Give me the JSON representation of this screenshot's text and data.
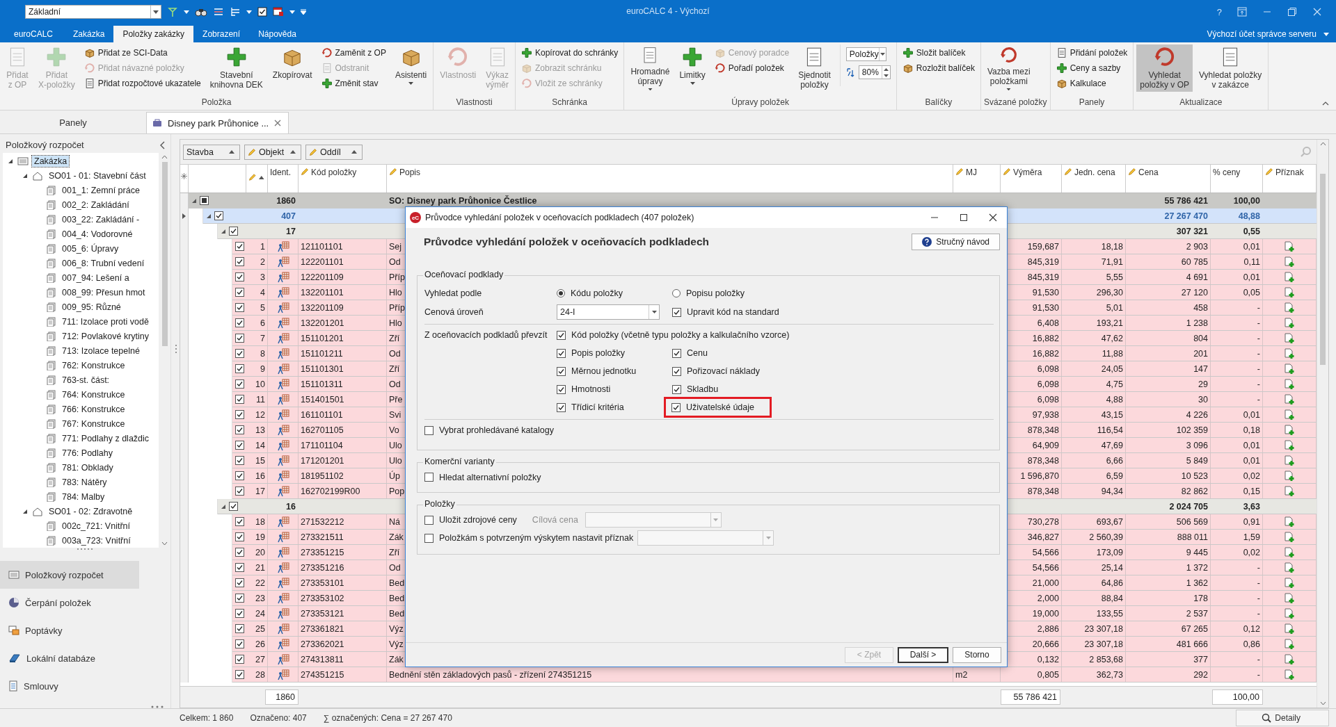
{
  "window": {
    "layout_combo": "Základní",
    "title": "euroCALC 4 - Výchozí",
    "help": "?"
  },
  "ribbon_tabs": [
    {
      "label": "euroCALC",
      "kind": "app",
      "selected": false
    },
    {
      "label": "Zakázka",
      "kind": "tab",
      "selected": false
    },
    {
      "label": "Položky zakázky",
      "kind": "tab",
      "selected": true
    },
    {
      "label": "Zobrazení",
      "kind": "tab",
      "selected": false
    },
    {
      "label": "Nápověda",
      "kind": "tab",
      "selected": false
    }
  ],
  "account": "Výchozí účet správce serveru",
  "ribbon_groups": [
    {
      "label": "Položka",
      "items": [
        {
          "kind": "large",
          "label": "Přidat\nz OP",
          "disabled": true,
          "dropdown": false,
          "pressed": false
        },
        {
          "kind": "large",
          "label": "Přidat\nX-položky",
          "disabled": true,
          "dropdown": false,
          "pressed": false
        },
        {
          "kind": "stack",
          "items": [
            {
              "label": "Přidat ze SCI-Data",
              "disabled": false
            },
            {
              "label": "Přidat návazné položky",
              "disabled": true
            },
            {
              "label": "Přidat rozpočtové ukazatele",
              "disabled": false
            }
          ]
        },
        {
          "kind": "large",
          "label": "Stavební\nknihovna DEK",
          "disabled": false,
          "dropdown": false,
          "pressed": false
        },
        {
          "kind": "large",
          "label": "Zkopírovat",
          "disabled": false,
          "dropdown": false,
          "pressed": false
        },
        {
          "kind": "stack",
          "items": [
            {
              "label": "Zaměnit z OP",
              "disabled": false
            },
            {
              "label": "Odstranit",
              "disabled": true
            },
            {
              "label": "Změnit stav",
              "disabled": false
            }
          ]
        },
        {
          "kind": "large",
          "label": "Asistenti",
          "disabled": false,
          "dropdown": true,
          "pressed": false
        }
      ]
    },
    {
      "label": "Vlastnosti",
      "items": [
        {
          "kind": "large",
          "label": "Vlastnosti",
          "disabled": true,
          "dropdown": false,
          "pressed": false
        },
        {
          "kind": "large",
          "label": "Výkaz\nvýměr",
          "disabled": true,
          "dropdown": false,
          "pressed": false
        }
      ]
    },
    {
      "label": "Schránka",
      "items": [
        {
          "kind": "stack",
          "items": [
            {
              "label": "Kopírovat do schránky",
              "disabled": false
            },
            {
              "label": "Zobrazit schránku",
              "disabled": true
            },
            {
              "label": "Vložit ze schránky",
              "disabled": true
            }
          ]
        }
      ]
    },
    {
      "label": "Úpravy položek",
      "items": [
        {
          "kind": "large",
          "label": "Hromadné\núpravy",
          "disabled": false,
          "dropdown": true,
          "pressed": false
        },
        {
          "kind": "large",
          "label": "Limitky",
          "disabled": false,
          "dropdown": true,
          "pressed": false
        },
        {
          "kind": "stack",
          "items": [
            {
              "label": "Cenový poradce",
              "disabled": true
            },
            {
              "label": "Pořadí položek",
              "disabled": false
            }
          ]
        },
        {
          "kind": "large",
          "label": "Sjednotit\npoložky",
          "disabled": false,
          "dropdown": false,
          "pressed": false
        },
        {
          "kind": "controls",
          "combo": "Položky",
          "spin": "80%"
        }
      ]
    },
    {
      "label": "Balíčky",
      "items": [
        {
          "kind": "stack",
          "items": [
            {
              "label": "Složit balíček",
              "disabled": false
            },
            {
              "label": "Rozložit balíček",
              "disabled": false
            }
          ]
        }
      ]
    },
    {
      "label": "Svázané položky",
      "items": [
        {
          "kind": "large",
          "label": "Vazba mezi\npoložkami",
          "disabled": false,
          "dropdown": true,
          "pressed": false
        }
      ]
    },
    {
      "label": "Panely",
      "items": [
        {
          "kind": "stack",
          "items": [
            {
              "label": "Přidání položek",
              "disabled": false
            },
            {
              "label": "Ceny a sazby",
              "disabled": false
            },
            {
              "label": "Kalkulace",
              "disabled": false
            }
          ]
        }
      ]
    },
    {
      "label": "Aktualizace",
      "items": [
        {
          "kind": "large",
          "label": "Vyhledat\npoložky v OP",
          "disabled": false,
          "dropdown": false,
          "pressed": true
        },
        {
          "kind": "large",
          "label": "Vyhledat položky\nv zakázce",
          "disabled": false,
          "dropdown": false,
          "pressed": false
        }
      ]
    }
  ],
  "panels_header": "Panely",
  "doc_tab": {
    "label": "Disney park Průhonice ..."
  },
  "side_panel": {
    "title": "Položkový rozpočet",
    "tree": [
      {
        "label": "Zakázka",
        "selected": true,
        "expanded": true,
        "children": [
          {
            "label": "SO01 - 01: Stavební část",
            "selected": false,
            "expanded": true,
            "children": [
              {
                "label": "001_1: Zemní práce",
                "selected": false
              },
              {
                "label": "002_2: Zakládání",
                "selected": false
              },
              {
                "label": "003_22: Zakládání -",
                "selected": false
              },
              {
                "label": "004_4: Vodorovné",
                "selected": false
              },
              {
                "label": "005_6: Úpravy",
                "selected": false
              },
              {
                "label": "006_8: Trubní vedení",
                "selected": false
              },
              {
                "label": "007_94: Lešení a",
                "selected": false
              },
              {
                "label": "008_99: Přesun hmot",
                "selected": false
              },
              {
                "label": "009_95: Různé",
                "selected": false
              },
              {
                "label": "711: Izolace proti vodě",
                "selected": false
              },
              {
                "label": "712: Povlakové krytiny",
                "selected": false
              },
              {
                "label": "713: Izolace tepelné",
                "selected": false
              },
              {
                "label": "762: Konstrukce",
                "selected": false
              },
              {
                "label": "763-st. část:",
                "selected": false
              },
              {
                "label": "764: Konstrukce",
                "selected": false
              },
              {
                "label": "766: Konstrukce",
                "selected": false
              },
              {
                "label": "767: Konstrukce",
                "selected": false
              },
              {
                "label": "771: Podlahy z dlaždic",
                "selected": false
              },
              {
                "label": "776: Podlahy",
                "selected": false
              },
              {
                "label": "781: Obklady",
                "selected": false
              },
              {
                "label": "783: Nátěry",
                "selected": false
              },
              {
                "label": "784: Malby",
                "selected": false
              }
            ]
          },
          {
            "label": "SO01 - 02: Zdravotně",
            "selected": false,
            "expanded": true,
            "children": [
              {
                "label": "002c_721: Vnitřní",
                "selected": false
              },
              {
                "label": "003a_723: Vnitřní",
                "selected": false
              }
            ]
          }
        ]
      }
    ],
    "nav": [
      {
        "label": "Položkový rozpočet",
        "selected": true
      },
      {
        "label": "Čerpání položek",
        "selected": false
      },
      {
        "label": "Poptávky",
        "selected": false
      },
      {
        "label": "Lokální databáze",
        "selected": false
      },
      {
        "label": "Smlouvy",
        "selected": false
      }
    ]
  },
  "group_by": [
    {
      "label": "Stavba",
      "editable": false
    },
    {
      "label": "Objekt",
      "editable": true
    },
    {
      "label": "Oddíl",
      "editable": true
    }
  ],
  "columns": [
    {
      "kind": "sort",
      "editable": true
    },
    {
      "label": "Ident.",
      "editable": false
    },
    {
      "label": "Kód položky",
      "editable": true
    },
    {
      "label": "Popis",
      "editable": true
    },
    {
      "label": "MJ",
      "editable": true
    },
    {
      "label": "Výměra",
      "editable": true
    },
    {
      "label": "Jedn. cena",
      "editable": true
    },
    {
      "label": "Cena",
      "editable": true
    },
    {
      "label": "% ceny",
      "editable": false
    },
    {
      "label": "Příznak",
      "editable": true
    }
  ],
  "total_row": {
    "label": "1860",
    "popis": "SO: Disney park Průhonice Čestlice",
    "cena": "55 786 421",
    "pct": "100,00",
    "partial": true,
    "expanded": true
  },
  "groups": [
    {
      "label": "407",
      "cena": "27 267 470",
      "pct": "48,88",
      "checked": true,
      "selected": true,
      "current": true,
      "expanded": true,
      "children": [
        {
          "label": "17",
          "cena": "307 321",
          "pct": "0,55",
          "checked": true,
          "selected": false,
          "current": false,
          "expanded": true,
          "rows": [
            {
              "n": "1",
              "code": "121101101",
              "popis": "Sej",
              "vymera": "159,687",
              "jc": "18,18",
              "cena": "2 903",
              "pct": "0,01",
              "checked": true
            },
            {
              "n": "2",
              "code": "122201101",
              "popis": "Od",
              "vymera": "845,319",
              "jc": "71,91",
              "cena": "60 785",
              "pct": "0,11",
              "checked": true
            },
            {
              "n": "3",
              "code": "122201109",
              "popis": "Příp",
              "vymera": "845,319",
              "jc": "5,55",
              "cena": "4 691",
              "pct": "0,01",
              "checked": true
            },
            {
              "n": "4",
              "code": "132201101",
              "popis": "Hlo",
              "vymera": "91,530",
              "jc": "296,30",
              "cena": "27 120",
              "pct": "0,05",
              "checked": true
            },
            {
              "n": "5",
              "code": "132201109",
              "popis": "Příp",
              "vymera": "91,530",
              "jc": "5,01",
              "cena": "458",
              "pct": "-",
              "checked": true
            },
            {
              "n": "6",
              "code": "132201201",
              "popis": "Hlo",
              "vymera": "6,408",
              "jc": "193,21",
              "cena": "1 238",
              "pct": "-",
              "checked": true
            },
            {
              "n": "7",
              "code": "151101201",
              "popis": "Zří",
              "vymera": "16,882",
              "jc": "47,62",
              "cena": "804",
              "pct": "-",
              "checked": true
            },
            {
              "n": "8",
              "code": "151101211",
              "popis": "Od",
              "vymera": "16,882",
              "jc": "11,88",
              "cena": "201",
              "pct": "-",
              "checked": true
            },
            {
              "n": "9",
              "code": "151101301",
              "popis": "Zří",
              "vymera": "6,098",
              "jc": "24,05",
              "cena": "147",
              "pct": "-",
              "checked": true
            },
            {
              "n": "10",
              "code": "151101311",
              "popis": "Od",
              "vymera": "6,098",
              "jc": "4,75",
              "cena": "29",
              "pct": "-",
              "checked": true
            },
            {
              "n": "11",
              "code": "151401501",
              "popis": "Pře",
              "vymera": "6,098",
              "jc": "4,88",
              "cena": "30",
              "pct": "-",
              "checked": true
            },
            {
              "n": "12",
              "code": "161101101",
              "popis": "Svi",
              "vymera": "97,938",
              "jc": "43,15",
              "cena": "4 226",
              "pct": "0,01",
              "checked": true
            },
            {
              "n": "13",
              "code": "162701105",
              "popis": "Vo",
              "vymera": "878,348",
              "jc": "116,54",
              "cena": "102 359",
              "pct": "0,18",
              "checked": true
            },
            {
              "n": "14",
              "code": "171101104",
              "popis": "Ulo",
              "vymera": "64,909",
              "jc": "47,69",
              "cena": "3 096",
              "pct": "0,01",
              "checked": true
            },
            {
              "n": "15",
              "code": "171201201",
              "popis": "Ulo",
              "vymera": "878,348",
              "jc": "6,66",
              "cena": "5 849",
              "pct": "0,01",
              "checked": true
            },
            {
              "n": "16",
              "code": "181951102",
              "popis": "Úp",
              "vymera": "1 596,870",
              "jc": "6,59",
              "cena": "10 523",
              "pct": "0,02",
              "checked": true
            },
            {
              "n": "17",
              "code": "162702199R00",
              "popis": "Pop",
              "vymera": "878,348",
              "jc": "94,34",
              "cena": "82 862",
              "pct": "0,15",
              "checked": true
            }
          ]
        },
        {
          "label": "16",
          "cena": "2 024 705",
          "pct": "3,63",
          "checked": true,
          "selected": false,
          "current": false,
          "expanded": true,
          "rows": [
            {
              "n": "18",
              "code": "271532212",
              "popis": "Ná",
              "vymera": "730,278",
              "jc": "693,67",
              "cena": "506 569",
              "pct": "0,91",
              "checked": true
            },
            {
              "n": "19",
              "code": "273321511",
              "popis": "Zák",
              "vymera": "346,827",
              "jc": "2 560,39",
              "cena": "888 011",
              "pct": "1,59",
              "checked": true
            },
            {
              "n": "20",
              "code": "273351215",
              "popis": "Zří",
              "vymera": "54,566",
              "jc": "173,09",
              "cena": "9 445",
              "pct": "0,02",
              "checked": true
            },
            {
              "n": "21",
              "code": "273351216",
              "popis": "Od",
              "vymera": "54,566",
              "jc": "25,14",
              "cena": "1 372",
              "pct": "-",
              "checked": true
            },
            {
              "n": "22",
              "code": "273353101",
              "popis": "Bed",
              "vymera": "21,000",
              "jc": "64,86",
              "cena": "1 362",
              "pct": "-",
              "checked": true
            },
            {
              "n": "23",
              "code": "273353102",
              "popis": "Bed",
              "vymera": "2,000",
              "jc": "88,84",
              "cena": "178",
              "pct": "-",
              "checked": true
            },
            {
              "n": "24",
              "code": "273353121",
              "popis": "Bed",
              "vymera": "19,000",
              "jc": "133,55",
              "cena": "2 537",
              "pct": "-",
              "checked": true
            },
            {
              "n": "25",
              "code": "273361821",
              "popis": "Výz",
              "vymera": "2,886",
              "jc": "23 307,18",
              "cena": "67 265",
              "pct": "0,12",
              "checked": true
            },
            {
              "n": "26",
              "code": "273362021",
              "popis": "Výz",
              "vymera": "20,666",
              "jc": "23 307,18",
              "cena": "481 666",
              "pct": "0,86",
              "checked": true
            },
            {
              "n": "27",
              "code": "274313811",
              "popis": "Zák",
              "vymera": "0,132",
              "jc": "2 853,68",
              "cena": "377",
              "pct": "-",
              "checked": true
            },
            {
              "n": "28",
              "code": "274351215",
              "popis": "Bednění stěn základových pasů - zřízení 274351215",
              "mj": "m2",
              "vymera": "0,805",
              "jc": "362,73",
              "cena": "292",
              "pct": "-",
              "checked": true
            }
          ]
        }
      ]
    }
  ],
  "summary": {
    "count": "1860",
    "cena": "55 786 421",
    "pct": "100,00"
  },
  "status_bar": {
    "total": "Celkem: 1 860",
    "marked": "Označeno: 407",
    "sum": "∑ označených: Cena = 27 267 470",
    "details": "Detaily"
  },
  "dialog": {
    "app_badge": "eC",
    "title": "Průvodce vyhledání položek v oceňovacích podkladech (407 položek)",
    "heading": "Průvodce vyhledání položek v oceňovacích podkladech",
    "help_button": "Stručný návod",
    "pricing": {
      "legend": "Oceňovací podklady",
      "search_by_label": "Vyhledat podle",
      "search_by": [
        {
          "label": "Kódu položky",
          "selected": true
        },
        {
          "label": "Popisu položky",
          "selected": false
        }
      ],
      "price_level_label": "Cenová úroveň",
      "price_level": "24-I",
      "standardize": {
        "label": "Upravit kód na standard",
        "checked": true
      },
      "take_label": "Z oceňovacích podkladů převzít",
      "take_items": [
        {
          "label": "Kód položky (včetně typu položky a kalkulačního vzorce)",
          "checked": true,
          "highlighted": false
        },
        {
          "label": "Popis položky",
          "checked": true,
          "highlighted": false
        },
        {
          "label": "Cenu",
          "checked": true,
          "highlighted": false
        },
        {
          "label": "Měrnou jednotku",
          "checked": true,
          "highlighted": false
        },
        {
          "label": "Pořizovací náklady",
          "checked": true,
          "highlighted": false
        },
        {
          "label": "Hmotnosti",
          "checked": true,
          "highlighted": false
        },
        {
          "label": "Skladbu",
          "checked": true,
          "highlighted": false
        },
        {
          "label": "Třídicí kritéria",
          "checked": true,
          "highlighted": false
        },
        {
          "label": "Uživatelské údaje",
          "checked": true,
          "highlighted": true
        }
      ],
      "select_catalogs": {
        "label": "Vybrat prohledávané katalogy",
        "checked": false
      }
    },
    "commercial": {
      "legend": "Komerční varianty",
      "alternatives": {
        "label": "Hledat alternativní položky",
        "checked": false
      }
    },
    "items_section": {
      "legend": "Položky",
      "save_prices": {
        "label": "Uložit zdrojové ceny",
        "checked": false
      },
      "target_price_label": "Cílová cena",
      "target_price_disabled": true,
      "set_flag": {
        "label": "Položkám s potvrzeným výskytem nastavit příznak",
        "checked": false
      }
    },
    "buttons": [
      {
        "label": "< Zpět",
        "disabled": true,
        "default": false
      },
      {
        "label": "Další >",
        "disabled": false,
        "default": true
      },
      {
        "label": "Storno",
        "disabled": false,
        "default": false
      }
    ]
  }
}
